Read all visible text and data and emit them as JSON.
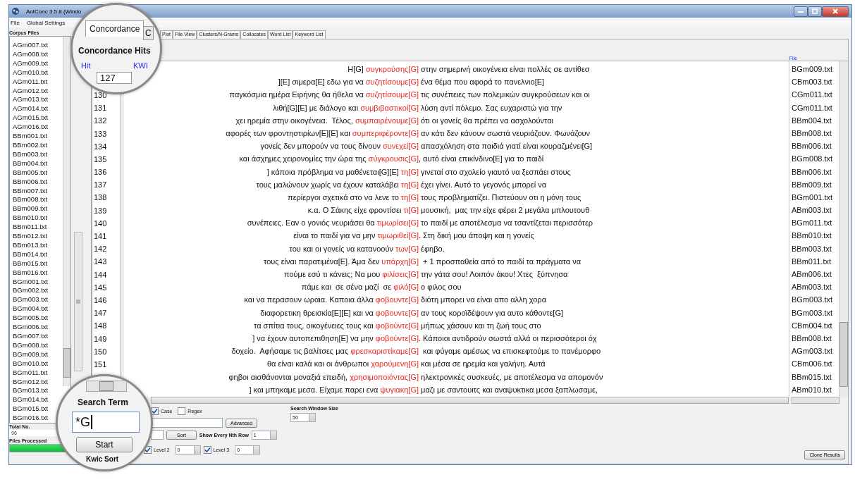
{
  "window": {
    "title": "AntConc 3.5.8 (Windo"
  },
  "menu": [
    "File",
    "Global Settings"
  ],
  "corpus_files": {
    "label": "Corpus Files",
    "files": [
      "AGm007.txt",
      "AGm008.txt",
      "AGm009.txt",
      "AGm010.txt",
      "AGm011.txt",
      "AGm012.txt",
      "AGm013.txt",
      "AGm014.txt",
      "AGm015.txt",
      "AGm016.txt",
      "BBm001.txt",
      "BBm002.txt",
      "BBm003.txt",
      "BBm004.txt",
      "BBm005.txt",
      "BBm006.txt",
      "BBm007.txt",
      "BBm008.txt",
      "BBm009.txt",
      "BBm010.txt",
      "BBm011.txt",
      "BBm012.txt",
      "BBm013.txt",
      "BBm014.txt",
      "BBm015.txt",
      "BBm016.txt",
      "BGm001.txt",
      "BGm002.txt",
      "BGm003.txt",
      "BGm004.txt",
      "BGm005.txt",
      "BGm006.txt",
      "BGm007.txt",
      "BGm008.txt",
      "BGm009.txt",
      "BGm010.txt",
      "BGm011.txt",
      "BGm012.txt",
      "BGm013.txt",
      "BGm014.txt",
      "BGm015.txt",
      "BGm016.txt"
    ],
    "total_label": "Total No.",
    "total": "96",
    "processed_label": "Files Processed",
    "progress": {
      "level": 1
    }
  },
  "tabs": [
    {
      "label": "Concordance",
      "selected": true
    },
    {
      "label": "C",
      "selected": false
    },
    {
      "label": "Plot",
      "selected": false
    },
    {
      "label": "File View",
      "selected": false
    },
    {
      "label": "Clusters/N-Grams",
      "selected": false
    },
    {
      "label": "Collocates",
      "selected": false
    },
    {
      "label": "Word List",
      "selected": false
    },
    {
      "label": "Keyword List",
      "selected": false
    }
  ],
  "concordance": {
    "hits_label": "Concordance Hits",
    "hit_header": "Hit",
    "kwic_header": "KWI",
    "lens_hit": "127",
    "file_header": "File",
    "rows": [
      {
        "left": "H[G]",
        "keyword": "συγκρούσης",
        "tag": "[G]",
        "right": " στην σημερινή οικογένεια είναι πολλές σε αντίθεσ",
        "file": "BGm009.txt"
      },
      {
        "left": "][E] σιμερα[E] εδω για να",
        "keyword": "συζητίσουμε",
        "tag": "[G]",
        "right": " ένα θέμα που αφορά το πανελνιο[E]",
        "file": "CBm003.txt"
      },
      {
        "hit": "130",
        "left": "παγκόσμια ημέρα Ειρήνης θα ήθελα να",
        "keyword": "συζητίσουμε",
        "tag": "[G]",
        "right": " τις συνέπειες των πολεμικών συγκρούσεων και οι",
        "file": "CGm011.txt"
      },
      {
        "hit": "131",
        "left": "λιθή[G][E] με διάλογο και",
        "keyword": "συμβιβαστικοί",
        "tag": "[G]",
        "right": " λύση αντί πόλεμο. Σας ευχαριστώ για την",
        "file": "CGm011.txt"
      },
      {
        "hit": "132",
        "left": "χει ηρεμία στην οικογένεια.  Τέλος,",
        "keyword": "συμπαιρένουμε",
        "tag": "[G]",
        "right": " ότι οι γονείς θα πρέπει να ασχολούνται",
        "file": "BBm004.txt"
      },
      {
        "hit": "133",
        "left": "αφορές των φροντηστιρίων[E][E] και",
        "keyword": "συμπεριφέροντε",
        "tag": "[G]",
        "right": " αν κάτι δεν κάνουν σωστά νευριάζουν. Φωνάζουν",
        "file": "BBm008.txt"
      },
      {
        "hit": "134",
        "left": "γονείς δεν μπορούν να τους δίνουν",
        "keyword": "συνεχεί",
        "tag": "[G]",
        "right": " απασχόληση στα παιδιά γιατί είναι κουραζμένει[G]",
        "file": "BBm006.txt"
      },
      {
        "hit": "135",
        "left": "και άσχημες χειρονομίες την ώρα της",
        "keyword": "σύγκρουσις",
        "tag": "[G]",
        "right": ", αυτό είναι επικίνδινο[E] για το παιδί",
        "file": "BGm008.txt"
      },
      {
        "hit": "136",
        "left": "] κάποια πρόβλημα να μαθένεται[G][E]",
        "keyword": "τη",
        "tag": "[G]",
        "right": " γινεταί στο σχολείο γιαυτό να ξεσπάει στους",
        "file": "BBm006.txt"
      },
      {
        "hit": "137",
        "left": "τους μαλώνουν χωρίς να έχουν καταλάβει",
        "keyword": "τη",
        "tag": "[G]",
        "right": " έχει γίνει. Αυτό το γεγονός μπορεί να",
        "file": "BBm009.txt"
      },
      {
        "hit": "138",
        "left": "περίεργοι σχετικά στο να λενε το",
        "keyword": "τη",
        "tag": "[G]",
        "right": " τους προβληματίζει. Πιστεύουν οτι η μόνη τους",
        "file": "BGm001.txt"
      },
      {
        "hit": "139",
        "left": "κ.α. Ο Σάκης είχε φροντίσει",
        "keyword": "τι",
        "tag": "[G]",
        "right": " μουσική,  μας την είχε φέρει 2 μεγάλα μπλουτουθ",
        "file": "ABm003.txt"
      },
      {
        "hit": "140",
        "left": "συνέπειες. Εαν ο γονιός νευριάσει θα",
        "keyword": "τιμωρίσει",
        "tag": "[G]",
        "right": " το παιδί με αποτέλεσμα να τσαντίζεται περισσότερ",
        "file": "BGm011.txt"
      },
      {
        "hit": "141",
        "left": "είναι το παιδί για να μην",
        "keyword": "τιμωριθεί",
        "tag": "[G]",
        "right": ". Στη δική μου άποψη και η γονείς",
        "file": "BBm010.txt"
      },
      {
        "hit": "142",
        "left": "του και οι γονείς να κατανοούν",
        "keyword": "των",
        "tag": "[G]",
        "right": " έφηβο.",
        "file": "BBm003.txt"
      },
      {
        "hit": "143",
        "left": "τους είναι παρατιμένα[E]. Άμα δεν",
        "keyword": "υπάρχη",
        "tag": "[G]",
        "right": "  + 1 προσπαθεία από το παιδί τα πράγματα να",
        "file": "BBm011.txt"
      },
      {
        "hit": "144",
        "left": "πούμε εσύ τι κάνεις; Να μου",
        "keyword": "φιλίσεις",
        "tag": "[G]",
        "right": " την γάτα σου! Λοιπόν άκου! Χτες  ξύπνησα",
        "file": "ABm006.txt"
      },
      {
        "hit": "145",
        "left": "πάμε και  σε σένα μαζί  σε",
        "keyword": "φιλό",
        "tag": "[G]",
        "right": " ο φιλος σου",
        "file": "ABm003.txt"
      },
      {
        "hit": "146",
        "left": "και να περασουν ωραια. Καποια άλλα",
        "keyword": "φοβουντε",
        "tag": "[G]",
        "right": " διότη μπορει να είναι απο αλλη χορα",
        "file": "BGm003.txt"
      },
      {
        "hit": "147",
        "left": "διαφορετικη θρεισκία[E][E] και να",
        "keyword": "φοβουντε",
        "tag": "[G]",
        "right": " αν τους κοροϊδέψουν για αυτο κάθοντε[G]",
        "file": "BGm003.txt"
      },
      {
        "hit": "148",
        "left": "τα σπίτια τους, οικογένειες τους και",
        "keyword": "φοβούντε",
        "tag": "[G]",
        "right": " μήπως χάσουν και τη ζωή τους στο",
        "file": "CBm004.txt"
      },
      {
        "hit": "149",
        "left": "] να έχουν αυτοπεπιθηση[E] να μην",
        "keyword": "φοβούντε",
        "tag": "[G]",
        "right": ". Κάποιοι αντιδρούν σωστά αλλά οι περισσότεροι όχ",
        "file": "BBm008.txt"
      },
      {
        "hit": "150",
        "left": "δοχείο.  Αφήσαμε τις βαλίτσες μας",
        "keyword": "φρεσκαριστίκαμε",
        "tag": "[G]",
        "right": "  και φύγαμε αμέσως να επισκεφτούμε το πανέμορφο",
        "file": "AGm003.txt"
      },
      {
        "hit": "151",
        "left": "θα είναι καλά και οι άνθρωποι",
        "keyword": "χαρούμενη",
        "tag": "[G]",
        "right": " και μέσα σε ηρεμία και γαλήνη. Αυτά",
        "file": "CBm006.txt"
      },
      {
        "left": "φηβοι αισθάνονται μοναξιά επειδή,",
        "keyword": "χρησιμοποιόντας",
        "tag": "[G]",
        "right": " ηλεκτρονικές συσκευές, με αποτέλεσμα να απομονόν",
        "file": "BBm015.txt"
      },
      {
        "left": "] και μπηκαμε μεσα. Είχαμε παρει ενα",
        "keyword": "ψυγιακη",
        "tag": "[G]",
        "right": " μαζι με σαντουιτς και αναψυκτικα μεσα ξαπλωσαμε,",
        "file": "ABm010.txt"
      }
    ]
  },
  "search": {
    "label": "Search Term",
    "value": "*G",
    "options": [
      {
        "label": "Case",
        "checked": true
      },
      {
        "label": "Regex",
        "checked": false
      }
    ],
    "advanced": "Advanced",
    "window_size_label": "Search Window Size",
    "window_size": "50",
    "sort": "Sort",
    "nth_row_label": "Show Every Nth Row",
    "nth_row": "1",
    "start": "Start",
    "kwic_sort_label": "Kwic Sort",
    "levels": [
      {
        "label": "Level 2",
        "checked": true,
        "value": "0"
      },
      {
        "label": "Level 3",
        "checked": true,
        "value": "0"
      }
    ]
  },
  "clone_button": "Clone Results"
}
